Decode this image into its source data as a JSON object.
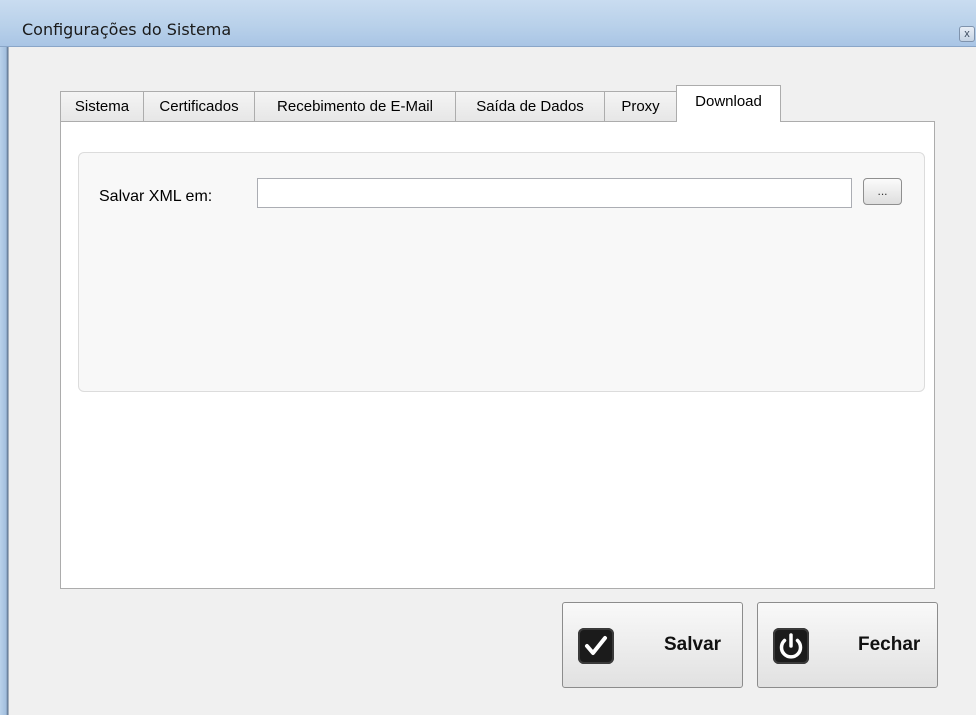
{
  "window": {
    "title": "Configurações do Sistema",
    "close_glyph": "x"
  },
  "tabs": [
    {
      "label": "Sistema"
    },
    {
      "label": "Certificados"
    },
    {
      "label": "Recebimento de E-Mail"
    },
    {
      "label": "Saída de Dados"
    },
    {
      "label": "Proxy"
    },
    {
      "label": "Download",
      "active": true
    }
  ],
  "download_tab": {
    "save_xml_label": "Salvar XML em:",
    "save_xml_value": "",
    "browse_label": "..."
  },
  "footer": {
    "save_label": "Salvar",
    "save_icon": "checkmark-icon",
    "close_label": "Fechar",
    "close_icon": "power-icon"
  },
  "colors": {
    "title_bar": "#b9d1ea",
    "window_bg": "#f0f0f0",
    "icon_bg": "#1b1b1b"
  }
}
